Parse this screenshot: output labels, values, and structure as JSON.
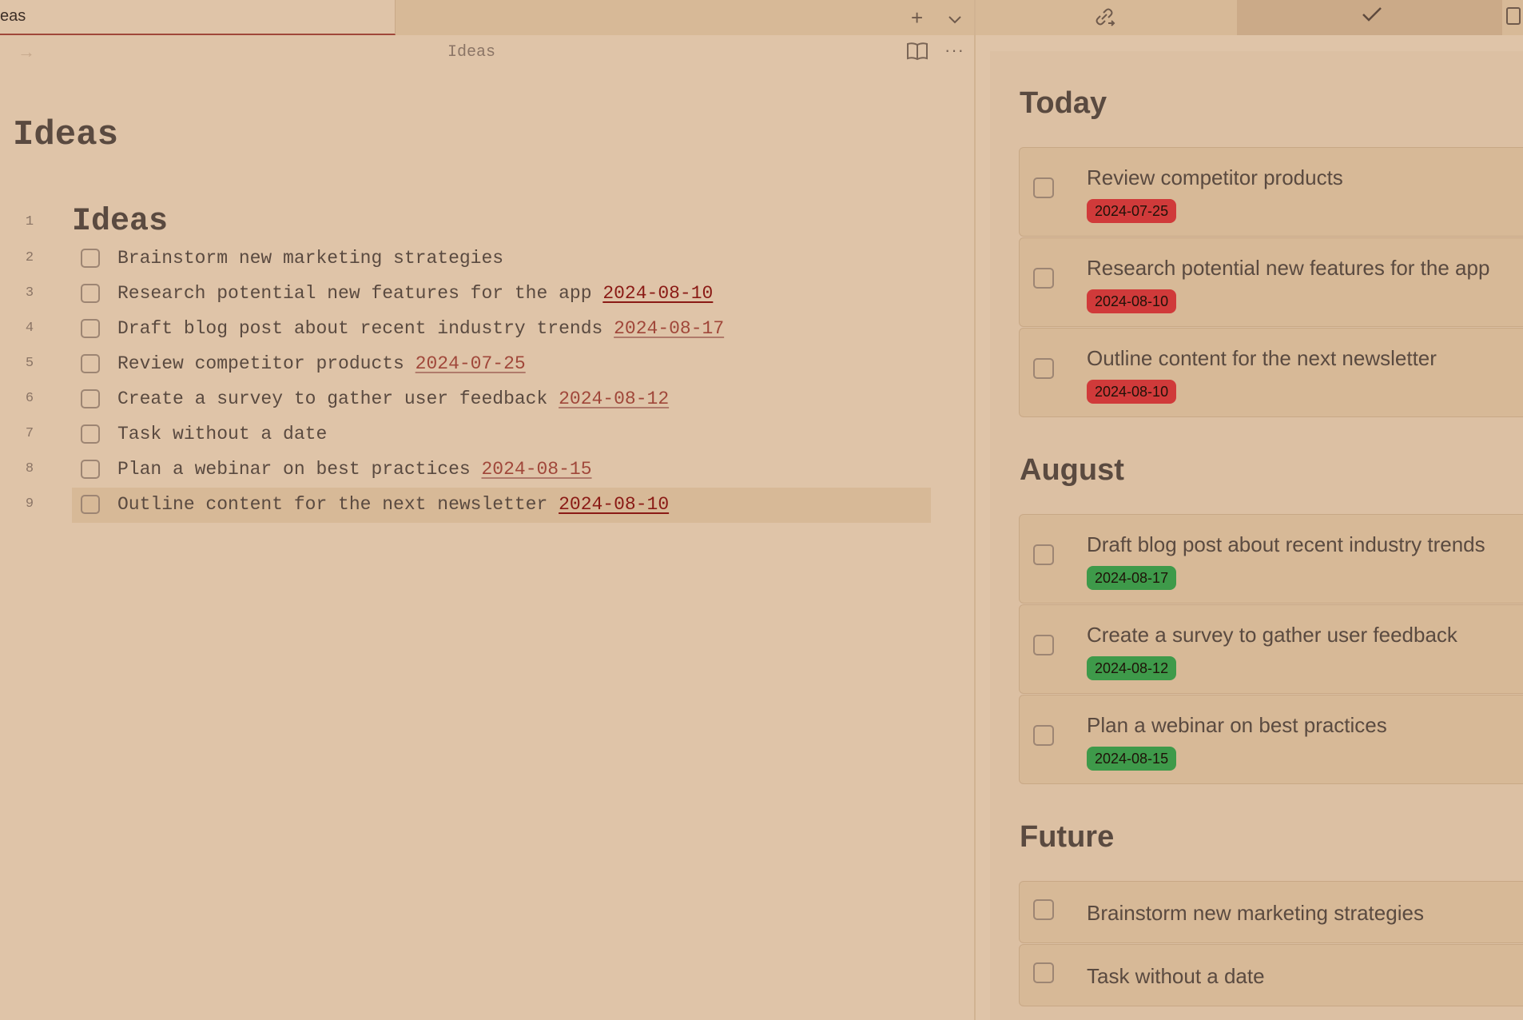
{
  "tab": {
    "title": "eas"
  },
  "header": {
    "title": "Ideas"
  },
  "note": {
    "title": "Ideas",
    "heading": "Ideas",
    "line_numbers": [
      "1",
      "2",
      "3",
      "4",
      "5",
      "6",
      "7",
      "8",
      "9"
    ],
    "tasks": [
      {
        "text": "Brainstorm new marketing strategies",
        "date": ""
      },
      {
        "text": "Research potential new features for the app ",
        "date": "2024-08-10"
      },
      {
        "text": "Draft blog post about recent industry trends ",
        "date": "2024-08-17"
      },
      {
        "text": "Review competitor products ",
        "date": "2024-07-25"
      },
      {
        "text": "Create a survey to gather user feedback ",
        "date": "2024-08-12"
      },
      {
        "text": "Task without a date",
        "date": ""
      },
      {
        "text": "Plan a webinar on best practices ",
        "date": "2024-08-15"
      },
      {
        "text": "Outline content for the next newsletter ",
        "date": "2024-08-10"
      }
    ]
  },
  "sidebar": {
    "sections": [
      {
        "title": "Today",
        "items": [
          {
            "text": "Review competitor products",
            "date": "2024-07-25"
          },
          {
            "text": "Research potential new features for the app",
            "date": "2024-08-10"
          },
          {
            "text": "Outline content for the next newsletter",
            "date": "2024-08-10"
          }
        ]
      },
      {
        "title": "August",
        "items": [
          {
            "text": "Draft blog post about recent industry trends",
            "date": "2024-08-17"
          },
          {
            "text": "Create a survey to gather user feedback",
            "date": "2024-08-12"
          },
          {
            "text": "Plan a webinar on best practices",
            "date": "2024-08-15"
          }
        ]
      },
      {
        "title": "Future",
        "items": [
          {
            "text": "Brainstorm new marketing strategies"
          },
          {
            "text": "Task without a date"
          }
        ]
      }
    ]
  },
  "colors": {
    "background": "#dfc4a8",
    "overdue_badge": "#d03a3a",
    "upcoming_badge": "#3e9a4a",
    "date_link": "#a0473a"
  },
  "icons": [
    "new-tab-icon",
    "tab-list-icon",
    "back-arrow-icon",
    "book-icon",
    "more-options-icon",
    "link-icon",
    "checkmark-icon",
    "sidebar-toggle-icon"
  ]
}
